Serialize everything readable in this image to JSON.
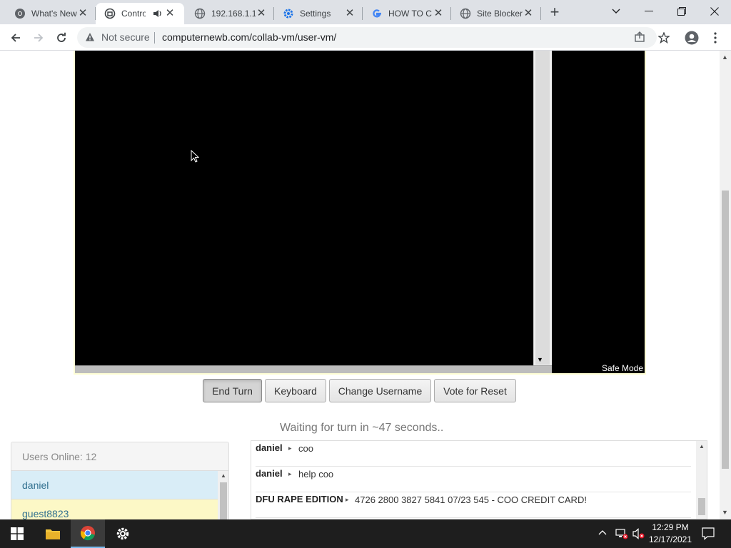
{
  "browser": {
    "tabs": [
      {
        "title": "What's New",
        "icon": "chrome-icon"
      },
      {
        "title": "Control",
        "icon": "collabvm-icon",
        "audio": true,
        "active": true
      },
      {
        "title": "192.168.1.1",
        "icon": "globe-icon"
      },
      {
        "title": "Settings",
        "icon": "gear-icon"
      },
      {
        "title": "HOW TO C",
        "icon": "google-icon"
      },
      {
        "title": "Site Blocker",
        "icon": "globe-icon"
      }
    ],
    "new_tab": "+",
    "security_label": "Not secure",
    "url": "computernewb.com/collab-vm/user-vm/"
  },
  "vm": {
    "safe_mode_label": "Safe Mode"
  },
  "buttons": {
    "end_turn": "End Turn",
    "keyboard": "Keyboard",
    "change_username": "Change Username",
    "vote_reset": "Vote for Reset"
  },
  "status": {
    "waiting": "Waiting for turn in ~47 seconds.."
  },
  "users": {
    "header": "Users Online: 12",
    "list": [
      {
        "name": "daniel",
        "color": "#d9edf7"
      },
      {
        "name": "guest8823",
        "color": "#fcf8c6"
      }
    ]
  },
  "chat": {
    "messages": [
      {
        "user": "daniel",
        "text": "coo"
      },
      {
        "user": "daniel",
        "text": "help coo"
      },
      {
        "user": "DFU RAPE EDITION",
        "text": "4726 2800 3827 5841 07/23 545 - COO CREDIT CARD!"
      }
    ]
  },
  "taskbar": {
    "time": "12:29 PM",
    "date": "12/17/2021"
  }
}
